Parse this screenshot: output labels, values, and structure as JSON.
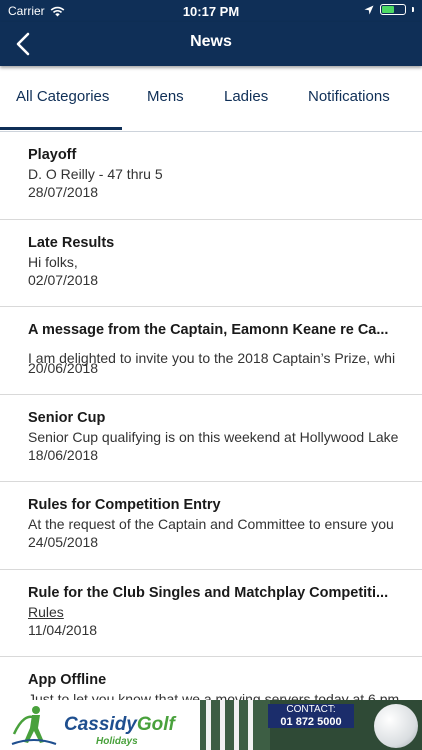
{
  "status_bar": {
    "carrier": "Carrier",
    "time": "10:17 PM",
    "battery_level": 0.55,
    "icons": [
      "wifi-icon",
      "location-arrow-icon",
      "battery-icon"
    ]
  },
  "nav": {
    "title": "News",
    "back_icon": "chevron-left-icon"
  },
  "tabs": [
    {
      "label": "All Categories",
      "active": true
    },
    {
      "label": "Mens",
      "active": false
    },
    {
      "label": "Ladies",
      "active": false
    },
    {
      "label": "Notifications",
      "active": false
    }
  ],
  "news": [
    {
      "title": "Playoff",
      "snippet": "D. O Reilly - 47 thru 5",
      "date": "28/07/2018"
    },
    {
      "title": "Late Results",
      "snippet": "Hi folks,",
      "date": "02/07/2018"
    },
    {
      "title": "A message from the Captain, Eamonn Keane re Ca...",
      "snippet": "I am delighted to invite you to the 2018 Captain’s Prize, whi",
      "date": "20/06/2018"
    },
    {
      "title": "Senior Cup",
      "snippet": "Senior Cup qualifying is on this weekend at Hollywood Lake",
      "date": "18/06/2018"
    },
    {
      "title": "Rules for Competition Entry",
      "snippet": "At the request of the Captain and Committee to ensure you",
      "date": "24/05/2018"
    },
    {
      "title": "Rule for the Club Singles and Matchplay Competiti...",
      "snippet": "Rules",
      "date": "11/04/2018"
    },
    {
      "title": "App Offline",
      "snippet": "Just to let you know that we a moving servers today at 6 pm",
      "date": ""
    }
  ],
  "banner": {
    "brand_part1": "Cassidy",
    "brand_part2": "Golf",
    "sub": "Holidays",
    "contact_label": "CONTACT:",
    "contact_phone": "01 872 5000"
  },
  "colors": {
    "navy": "#0f2f57",
    "brand_blue": "#1f4f8f",
    "brand_green": "#49a13c"
  }
}
